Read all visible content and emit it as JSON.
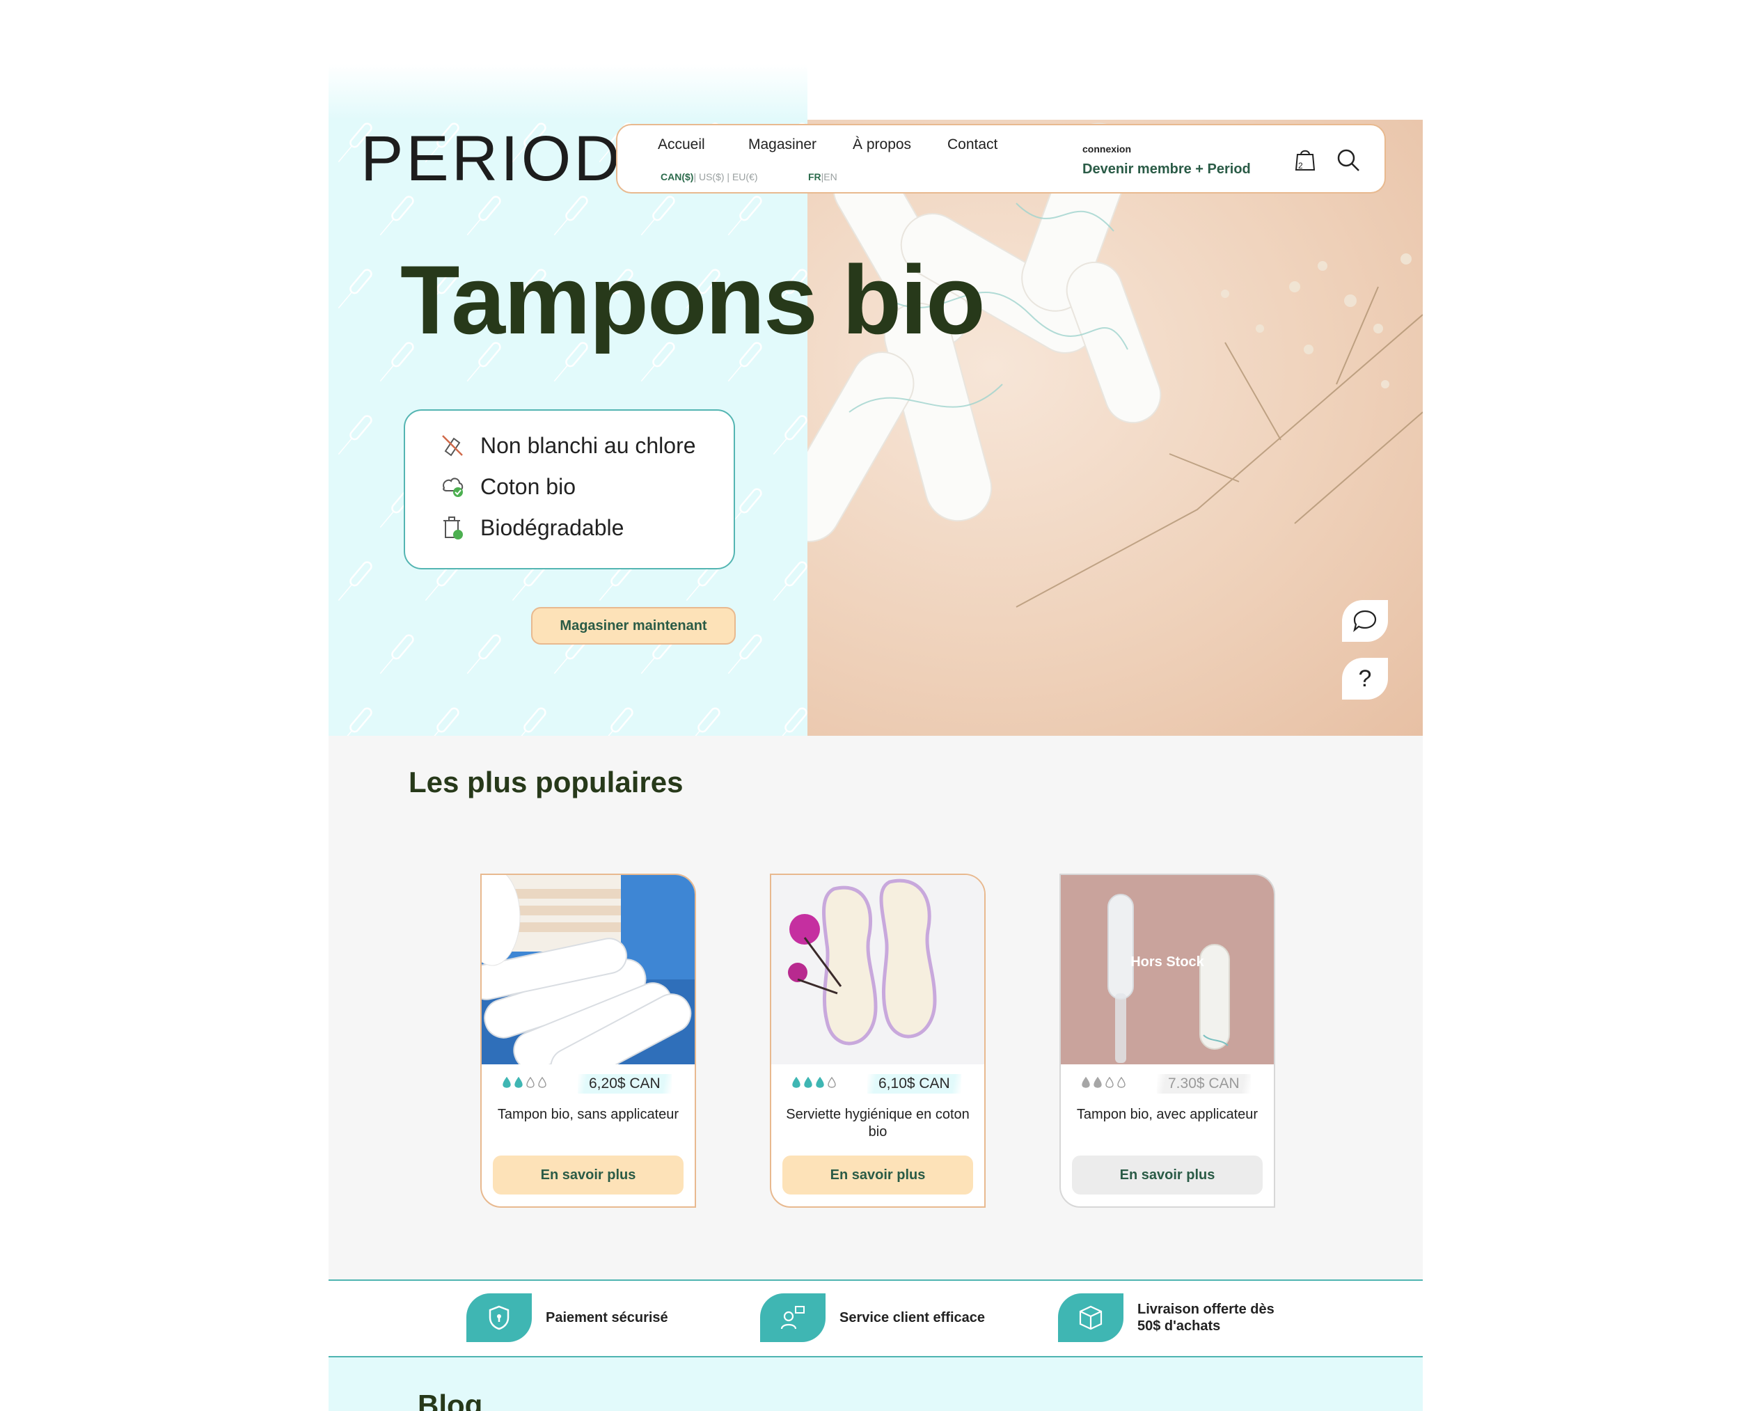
{
  "brand": {
    "logo": "PERIOD"
  },
  "nav": {
    "links": [
      "Accueil",
      "Magasiner",
      "À propos",
      "Contact"
    ],
    "currency_selected": "CAN($)",
    "currency_others": "| US($) | EU(€)",
    "lang_selected": "FR",
    "lang_other": "|EN",
    "login": "connexion",
    "member": "Devenir membre + Period",
    "cart_count": "2",
    "cart_icon": "shopping-bag-icon",
    "search_icon": "search-icon"
  },
  "hero": {
    "title": "Tampons bio",
    "features": [
      {
        "icon": "no-bleach-icon",
        "label": "Non blanchi au chlore"
      },
      {
        "icon": "cotton-icon",
        "label": "Coton bio"
      },
      {
        "icon": "recycle-bin-icon",
        "label": "Biodégradable"
      }
    ],
    "cta": "Magasiner maintenant",
    "chat_icon": "chat-bubble-icon",
    "help_label": "?"
  },
  "popular": {
    "title": "Les plus populaires",
    "products": [
      {
        "name": "Tampon bio, sans applicateur",
        "price": "6,20$ CAN",
        "drops": 2,
        "button": "En savoir plus",
        "out_of_stock": false
      },
      {
        "name": "Serviette hygiénique en coton bio",
        "price": "6,10$ CAN",
        "drops": 3,
        "button": "En savoir plus",
        "out_of_stock": false
      },
      {
        "name": "Tampon bio, avec applicateur",
        "price": "7.30$ CAN",
        "drops": 2,
        "button": "En savoir plus",
        "out_of_stock": true,
        "badge": "Hors Stock"
      }
    ]
  },
  "guarantees": [
    {
      "icon": "shield-lock-icon",
      "label": "Paiement sécurisé"
    },
    {
      "icon": "support-agent-icon",
      "label": "Service client efficace"
    },
    {
      "icon": "package-icon",
      "label": "Livraison offerte dès 50$ d'achats"
    }
  ],
  "blog": {
    "title": "Blog"
  },
  "colors": {
    "accent": "#3fb6b3",
    "cta": "#fde2b8",
    "dark_green": "#27391a",
    "hero_bg": "#e2fafb"
  }
}
